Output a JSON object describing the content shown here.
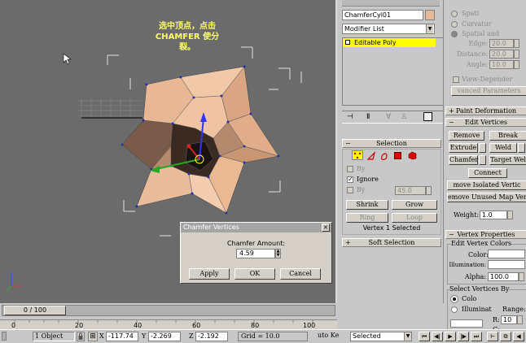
{
  "viewport": {
    "note_line1": "选中顶点，点击",
    "note_line2": "CHAMFER 使分",
    "note_line3": "裂。"
  },
  "dialog": {
    "title": "Chamfer Vertices",
    "amount_label": "Chamfer Amount:",
    "amount_value": "4.59",
    "apply": "Apply",
    "ok": "OK",
    "cancel": "Cancel",
    "close": "×"
  },
  "modify_panel": {
    "object_name": "ChamferCyl01",
    "modifier_list": "Modifier List",
    "stack_item": "Editable Poly",
    "selection_title": "Selection",
    "by_label": "By",
    "ignore_label": "Ignore",
    "by_angle_label": "By",
    "by_angle_value": "45.0",
    "shrink": "Shrink",
    "grow": "Grow",
    "ring": "Ring",
    "loop": "Loop",
    "selected_status": "Vertex 1 Selected",
    "soft_selection_title": "Soft Selection"
  },
  "right_panel": {
    "spatial": "Spati",
    "curvature": "Curvatur",
    "spatial_and": "Spatial and",
    "edge_label": "Edge:",
    "edge_value": "20.0",
    "distance_label": "Distance:",
    "distance_value": "20.0",
    "angle_label": "Angle:",
    "angle_value": "10.0",
    "view_dependent": "View-Depender",
    "advanced": "vanced Parameters",
    "paint_deformation": "Paint Deformation",
    "edit_vertices": "Edit Vertices",
    "remove": "Remove",
    "break": "Break",
    "extrude": "Extrude",
    "weld": "Weld",
    "chamfer": "Chamfer",
    "target_weld": "Target Wel",
    "connect": "Connect",
    "remove_isolated": "move Isolated Vertic",
    "remove_unused": "emove Unused Map Vert",
    "weight_label": "Weight:",
    "weight_value": "1.0",
    "vertex_properties": "Vertex Properties",
    "edit_vertex_colors": "Edit Vertex Colors",
    "color_label": "Color:",
    "illumination_label": "Illumination:",
    "alpha_label": "Alpha:",
    "alpha_value": "100.0",
    "select_vertices_by": "Select Vertices By",
    "colo": "Colo",
    "illuminat": "Illuminat",
    "range_label": "Range:",
    "r_label": "R:",
    "r_value": "10",
    "g_label": "G:"
  },
  "timeline": {
    "frame_display": "0 / 100",
    "ticks": [
      "0",
      "20",
      "40",
      "60",
      "80",
      "100"
    ]
  },
  "status": {
    "object_count": "1 Object",
    "x_label": "X",
    "x_value": "-117.74",
    "y_label": "Y",
    "y_value": "-2.269",
    "z_label": "Z",
    "z_value": "-2.192",
    "grid": "Grid = 10.0",
    "auto_key": "uto Ke",
    "selected_dropdown": "Selected"
  },
  "colors": {
    "viewport_bg": "#6b6b6b",
    "accent_yellow": "#ffff00",
    "object_color": "#e8b896",
    "note_color": "#ffff66"
  }
}
